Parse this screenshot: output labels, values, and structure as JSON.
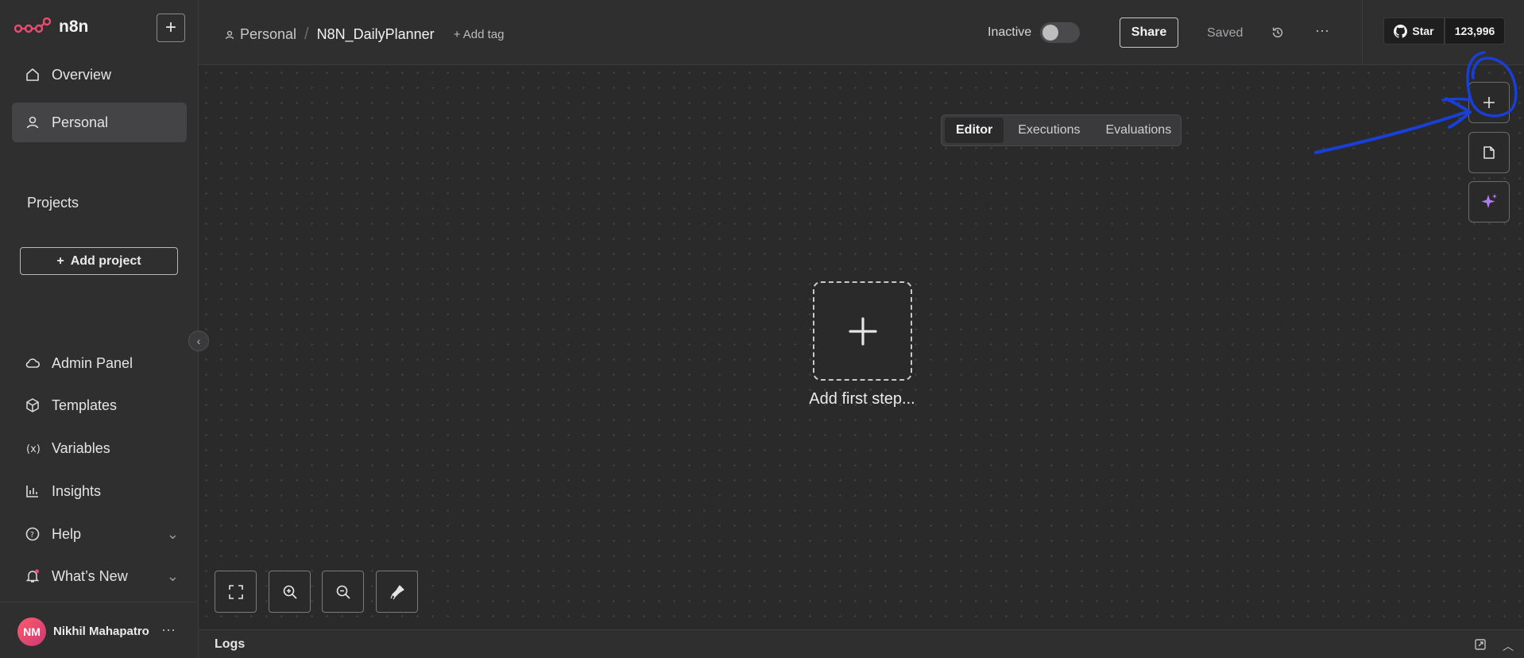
{
  "app": {
    "name": "n8n"
  },
  "sidebar": {
    "new_label": "+",
    "items": [
      {
        "label": "Overview",
        "icon": "home-icon"
      },
      {
        "label": "Personal",
        "icon": "user-icon",
        "active": true
      }
    ],
    "projects_title": "Projects",
    "add_project_label": "Add project",
    "bottom_items": [
      {
        "label": "Admin Panel",
        "icon": "cloud-icon"
      },
      {
        "label": "Templates",
        "icon": "box-icon"
      },
      {
        "label": "Variables",
        "icon": "variable-icon"
      },
      {
        "label": "Insights",
        "icon": "chart-icon"
      },
      {
        "label": "Help",
        "icon": "help-icon"
      },
      {
        "label": "What’s New",
        "icon": "bell-icon"
      }
    ],
    "user": {
      "initials": "NM",
      "name": "Nikhil Mahapatro"
    }
  },
  "header": {
    "breadcrumb_project": "Personal",
    "breadcrumb_sep": "/",
    "workflow_name": "N8N_DailyPlanner",
    "add_tag": "+ Add tag",
    "status_label": "Inactive",
    "share_label": "Share",
    "saved_label": "Saved",
    "github_star_label": "Star",
    "github_star_count": "123,996"
  },
  "tabs": [
    {
      "label": "Editor",
      "active": true
    },
    {
      "label": "Executions",
      "active": false
    },
    {
      "label": "Evaluations",
      "active": false
    }
  ],
  "canvas": {
    "add_first_step_label": "Add first step..."
  },
  "logs": {
    "label": "Logs"
  },
  "colors": {
    "brand": "#ea4b71",
    "annotation": "#1a3fd6",
    "ai_sparkle": "#b07cf0"
  }
}
